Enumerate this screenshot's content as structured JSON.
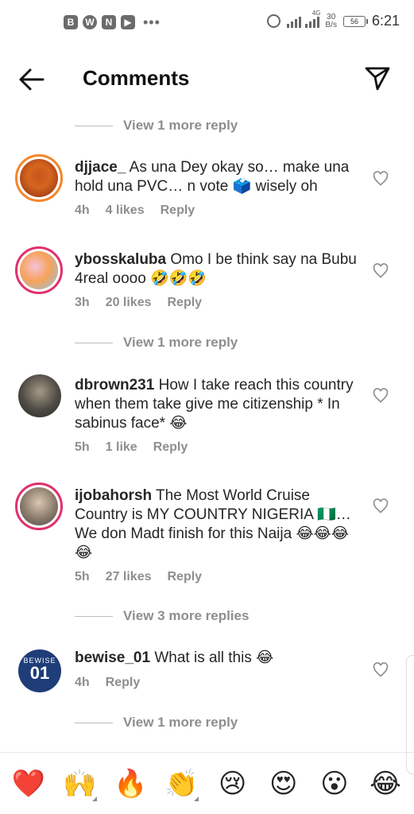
{
  "status": {
    "time": "6:21",
    "net_speed_top": "30",
    "net_speed_bottom": "B/s",
    "battery": "56",
    "signal_label": "4G",
    "notif_icons": [
      "B",
      "W",
      "N",
      "▶"
    ]
  },
  "header": {
    "title": "Comments"
  },
  "view_more": {
    "r1": "View 1 more reply",
    "r2": "View 1 more reply",
    "r3": "View 3 more replies",
    "r4": "View 1 more reply"
  },
  "comments": [
    {
      "user": "djjace_",
      "text": " As una Dey okay so… make una hold una PVC… n vote 🗳️ wisely oh",
      "time": "4h",
      "likes": "4 likes",
      "reply": "Reply"
    },
    {
      "user": "ybosskaluba",
      "text": " Omo I be think say na Bubu 4real oooo 🤣🤣🤣",
      "time": "3h",
      "likes": "20 likes",
      "reply": "Reply"
    },
    {
      "user": "dbrown231",
      "text": " How I take reach this country when them take give me citizenship * In sabinus face* 😂",
      "time": "5h",
      "likes": "1 like",
      "reply": "Reply"
    },
    {
      "user": "ijobahorsh",
      "text": " The Most World Cruise Country is MY COUNTRY NIGERIA 🇳🇬… We don Madt finish for this Naija 😂😂😂😂",
      "time": "5h",
      "likes": "27 likes",
      "reply": "Reply"
    },
    {
      "user": "bewise_01",
      "text": " What is all this 😂",
      "time": "4h",
      "likes": "",
      "reply": "Reply"
    }
  ],
  "emojis": [
    "❤️",
    "🙌",
    "🔥",
    "👏",
    "😢",
    "😍",
    "😮",
    "😂"
  ],
  "colors": {
    "story_ring": "#e1306c",
    "heart": "#ed4956"
  }
}
